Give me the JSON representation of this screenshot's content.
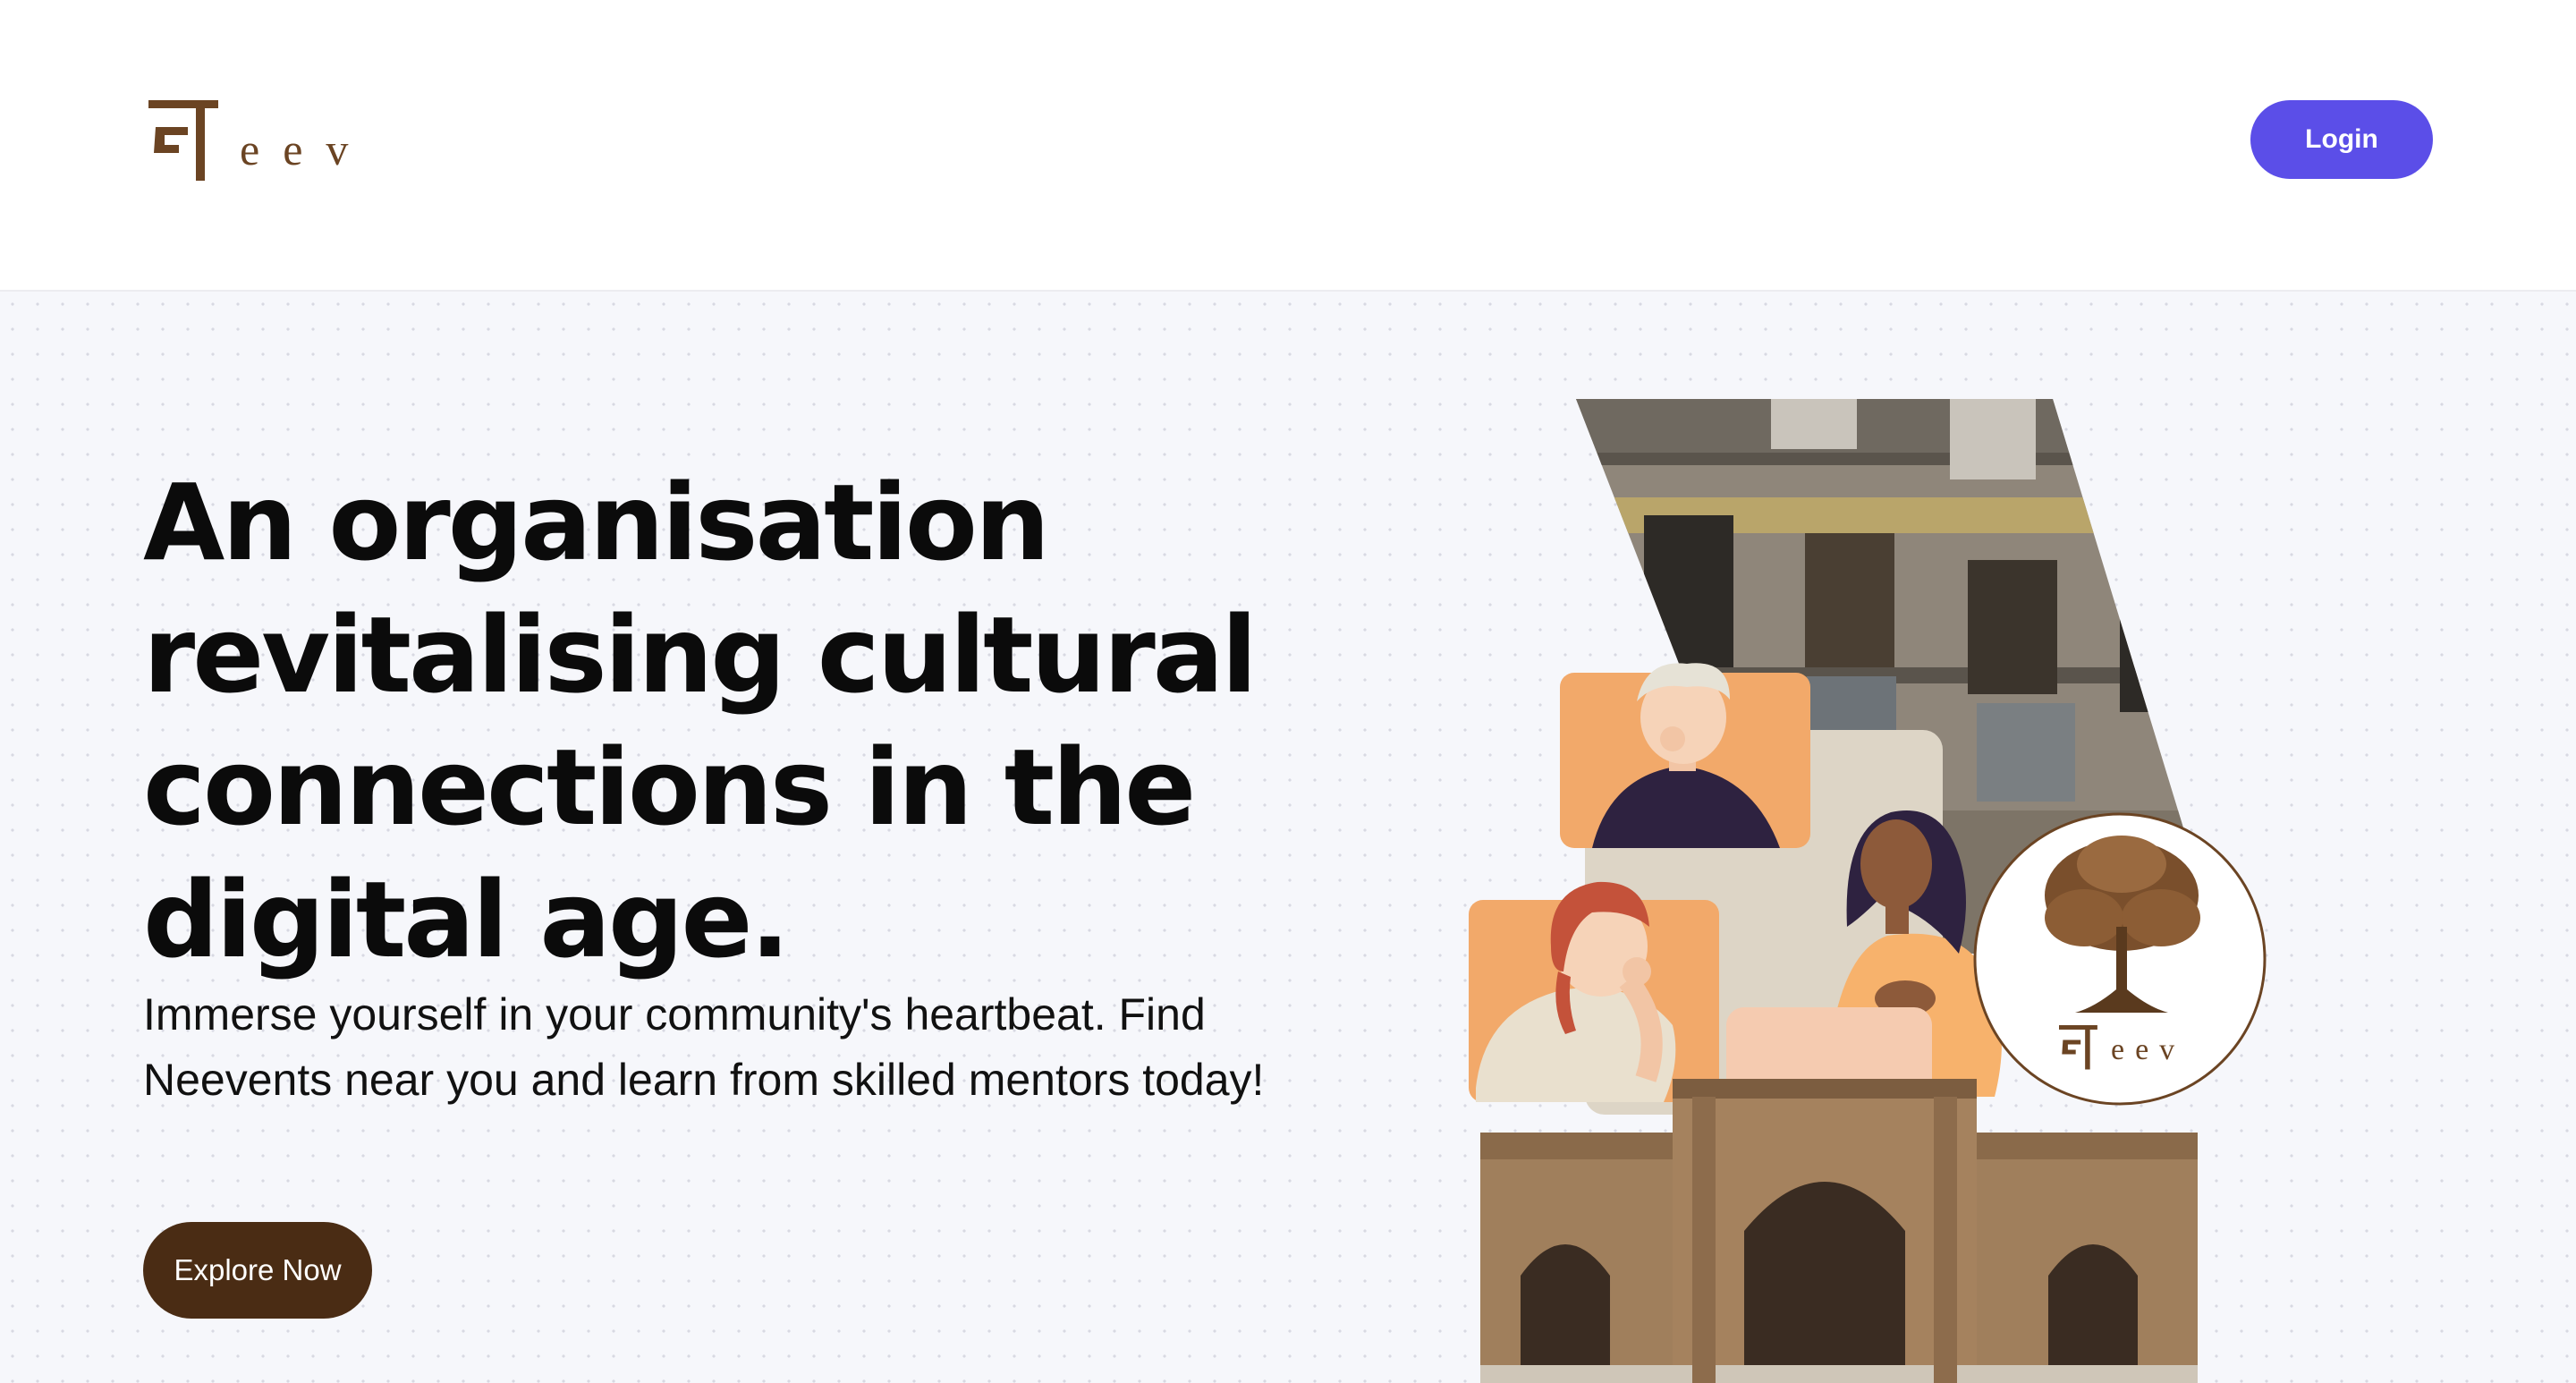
{
  "header": {
    "logo": {
      "devanagari": "न",
      "text": "eev"
    },
    "login_label": "Login"
  },
  "hero": {
    "headline": "An organisation revitalising cultural connections in the digital age.",
    "subtext": "Immerse yourself in your community's heartbeat. Find Neevents near you and learn from skilled mentors today!",
    "cta_label": "Explore Now",
    "badge_logo": {
      "devanagari": "न",
      "text": "eev"
    }
  },
  "colors": {
    "brand_brown": "#6b4423",
    "cta_brown": "#4a2c14",
    "login_purple": "#5b4ee8",
    "hero_bg": "#f6f7fb",
    "peach": "#f2a96a",
    "beige": "#ddd5c6"
  }
}
